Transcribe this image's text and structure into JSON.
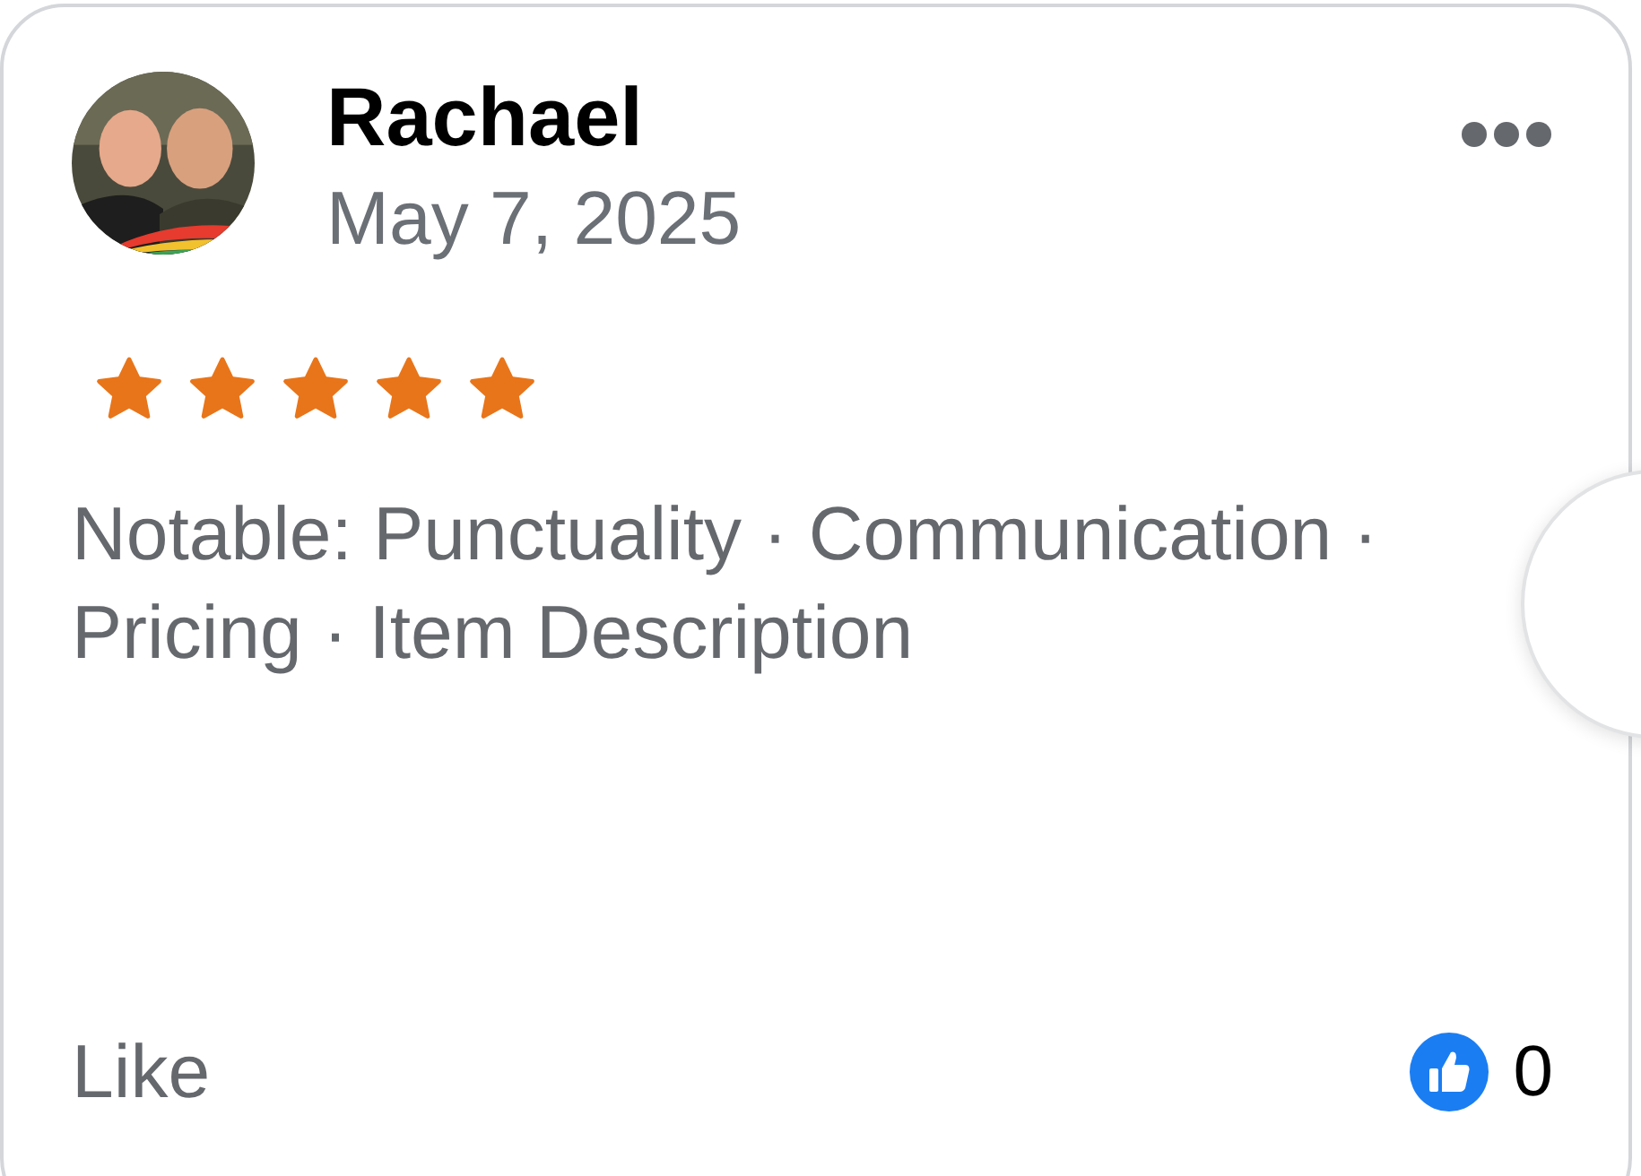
{
  "review": {
    "author": "Rachael",
    "date": "May 7, 2025",
    "stars": 5,
    "notable": "Notable: Punctuality · Communication · Pricing · Item Description",
    "like_label": "Like",
    "like_count": "0"
  }
}
